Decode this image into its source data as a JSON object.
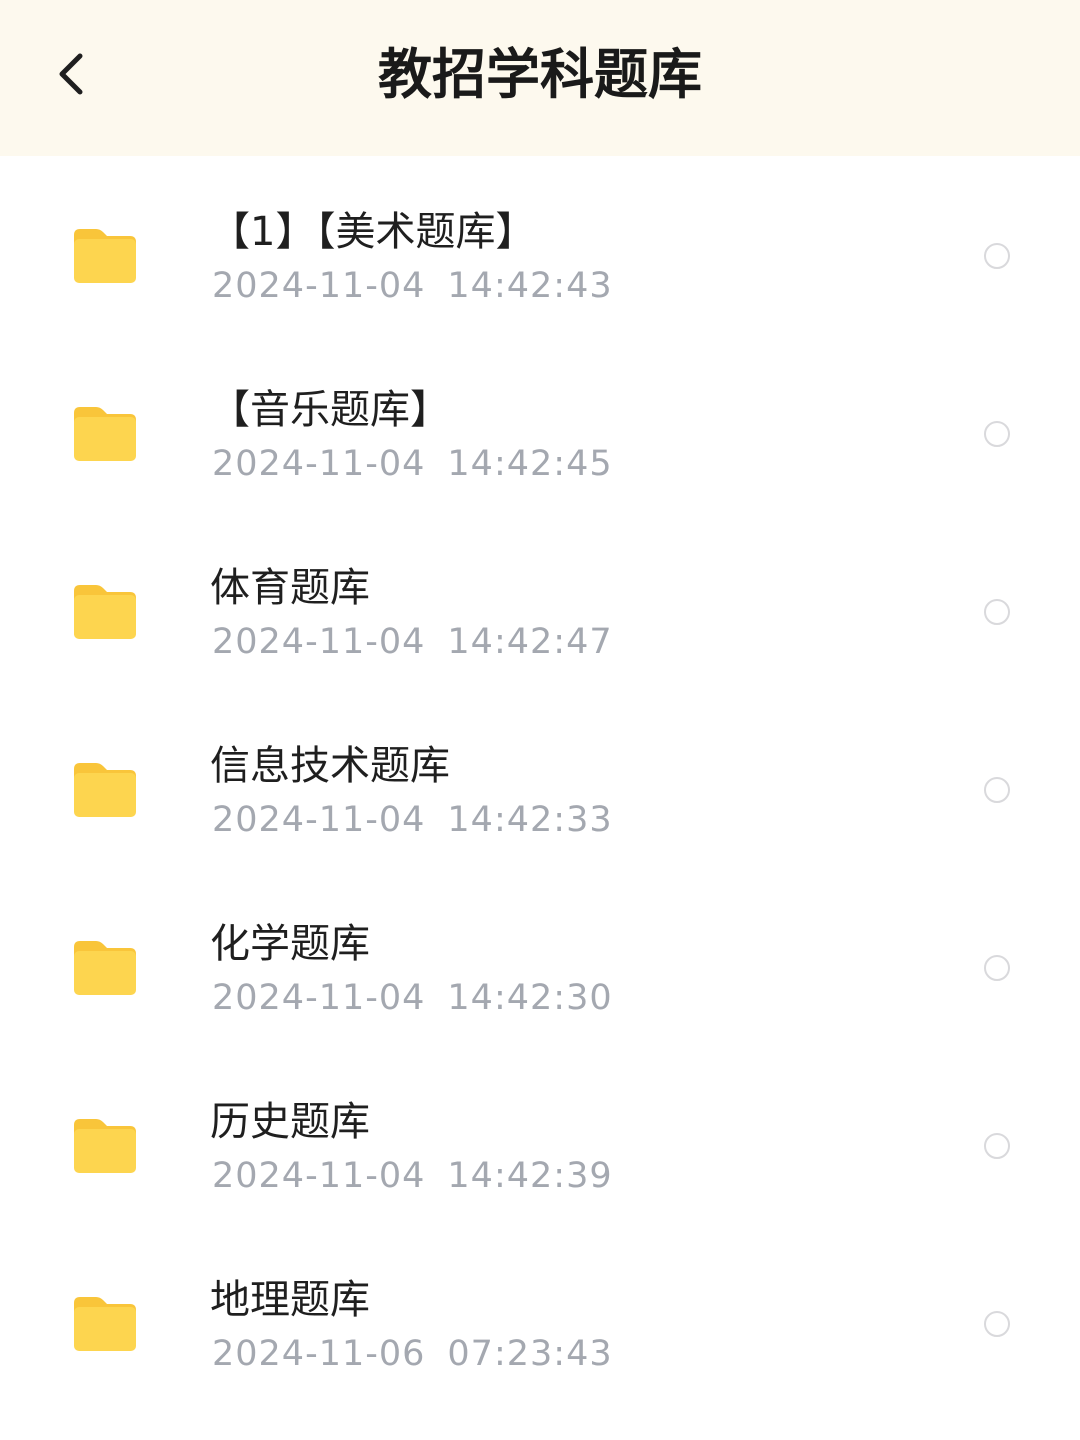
{
  "header": {
    "title": "教招学科题库",
    "back_icon": "chevron-left-icon"
  },
  "colors": {
    "header_bg": "#fdf9ee",
    "folder": "#fdd54f",
    "folder_tab": "#f9c53a",
    "timestamp": "#a4a8b0"
  },
  "items": [
    {
      "name": "【1】【美术题库】",
      "date": "2024-11-04",
      "time": "14:42:43",
      "icon": "folder-icon",
      "selected": false
    },
    {
      "name": "【音乐题库】",
      "date": "2024-11-04",
      "time": "14:42:45",
      "icon": "folder-icon",
      "selected": false
    },
    {
      "name": "体育题库",
      "date": "2024-11-04",
      "time": "14:42:47",
      "icon": "folder-icon",
      "selected": false
    },
    {
      "name": "信息技术题库",
      "date": "2024-11-04",
      "time": "14:42:33",
      "icon": "folder-icon",
      "selected": false
    },
    {
      "name": "化学题库",
      "date": "2024-11-04",
      "time": "14:42:30",
      "icon": "folder-icon",
      "selected": false
    },
    {
      "name": "历史题库",
      "date": "2024-11-04",
      "time": "14:42:39",
      "icon": "folder-icon",
      "selected": false
    },
    {
      "name": "地理题库",
      "date": "2024-11-06",
      "time": "07:23:43",
      "icon": "folder-icon",
      "selected": false
    }
  ]
}
